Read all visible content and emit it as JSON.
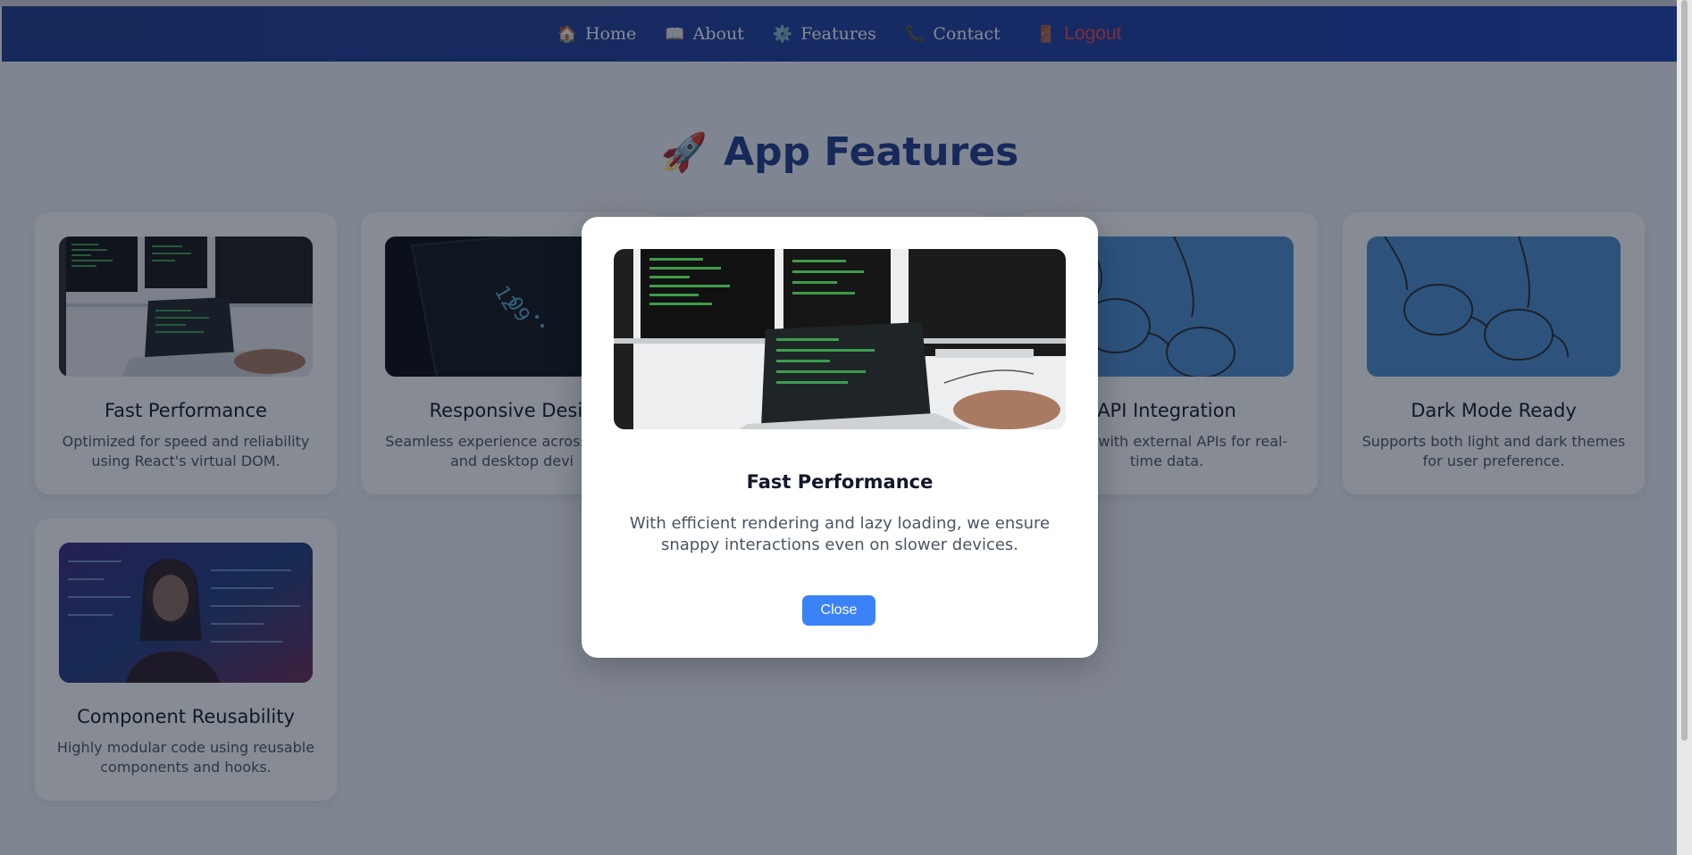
{
  "nav": {
    "items": [
      {
        "icon": "🏠",
        "label": "Home"
      },
      {
        "icon": "📖",
        "label": "About"
      },
      {
        "icon": "⚙️",
        "label": "Features"
      },
      {
        "icon": "📞",
        "label": "Contact"
      }
    ],
    "logout": {
      "icon": "🚪",
      "label": "Logout"
    }
  },
  "page": {
    "title_icon": "🚀",
    "title": "App Features"
  },
  "cards": [
    {
      "title": "Fast Performance",
      "description": "Optimized for speed and reliability using React's virtual DOM.",
      "image": "code-monitors"
    },
    {
      "title": "Responsive Desig",
      "description": "Seamless experience across tablet, and desktop devi",
      "image": "phone-screen"
    },
    {
      "title": "API Integration",
      "description": "nnects with external APIs for real-time data.",
      "image": "glasses"
    },
    {
      "title": "Dark Mode Ready",
      "description": "Supports both light and dark themes for user preference.",
      "image": "glasses"
    },
    {
      "title": "Component Reusability",
      "description": "Highly modular code using reusable components and hooks.",
      "image": "matrix-person"
    }
  ],
  "modal": {
    "title": "Fast Performance",
    "description": "With efficient rendering and lazy loading, we ensure snappy interactions even on slower devices.",
    "close_label": "Close",
    "image": "code-monitors"
  },
  "colors": {
    "nav_bg": "#1e3a8a",
    "title": "#1e3a8a",
    "logout": "#ef4444",
    "close_button": "#3b82f6"
  }
}
